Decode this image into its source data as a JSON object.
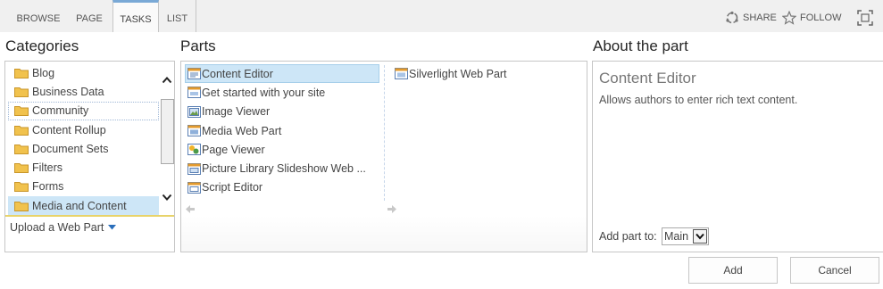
{
  "ribbon": {
    "tabs": [
      {
        "label": "BROWSE"
      },
      {
        "label": "PAGE"
      },
      {
        "label": "TASKS"
      },
      {
        "label": "LIST"
      }
    ],
    "share_label": "SHARE",
    "follow_label": "FOLLOW"
  },
  "categories": {
    "heading": "Categories",
    "items": [
      {
        "label": "Blog"
      },
      {
        "label": "Business Data"
      },
      {
        "label": "Community"
      },
      {
        "label": "Content Rollup"
      },
      {
        "label": "Document Sets"
      },
      {
        "label": "Filters"
      },
      {
        "label": "Forms"
      },
      {
        "label": "Media and Content"
      }
    ],
    "selected": "Media and Content",
    "upload_label": "Upload a Web Part"
  },
  "parts": {
    "heading": "Parts",
    "column1": [
      {
        "label": "Content Editor"
      },
      {
        "label": "Get started with your site"
      },
      {
        "label": "Image Viewer"
      },
      {
        "label": "Media Web Part"
      },
      {
        "label": "Page Viewer"
      },
      {
        "label": "Picture Library Slideshow Web ..."
      },
      {
        "label": "Script Editor"
      }
    ],
    "column2": [
      {
        "label": "Silverlight Web Part"
      }
    ],
    "selected": "Content Editor"
  },
  "about": {
    "heading": "About the part",
    "title": "Content Editor",
    "description": "Allows authors to enter rich text content.",
    "add_to_label": "Add part to:",
    "add_to_value": "Main"
  },
  "buttons": {
    "add": "Add",
    "cancel": "Cancel"
  },
  "colors": {
    "selection": "#cde6f7",
    "ribbon_bg": "#f0f0f0",
    "active_tab_accent": "#7aa9d6"
  }
}
